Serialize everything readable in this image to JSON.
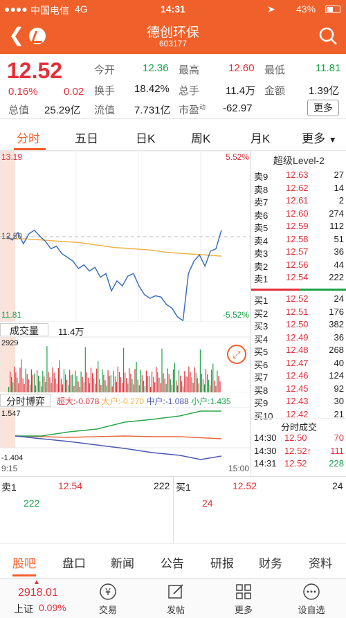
{
  "status": {
    "carrier": "中国电信",
    "network": "4G",
    "time": "14:31",
    "battery": "43%"
  },
  "header": {
    "name": "德创环保",
    "code": "603177"
  },
  "quote": {
    "price": "12.52",
    "pct": "0.16%",
    "chg": "0.02",
    "cap_label": "总值",
    "cap_value": "25.29亿",
    "open_label": "今开",
    "open_value": "12.36",
    "turnover_label": "换手",
    "turnover_value": "18.42%",
    "float_label": "流值",
    "float_value": "7.731亿",
    "high_label": "最高",
    "high_value": "12.60",
    "volume_label": "总手",
    "volume_value": "11.4万",
    "pe_label": "市盈",
    "pe_sup": "动",
    "pe_value": "-62.97",
    "low_label": "最低",
    "low_value": "11.81",
    "amount_label": "金额",
    "amount_value": "1.39亿",
    "more_label": "更多"
  },
  "tabs": [
    "分时",
    "五日",
    "日K",
    "周K",
    "月K",
    "更多"
  ],
  "chart": {
    "price_top": "13.19",
    "price_mid": "12.50",
    "price_bot": "11.81",
    "pct_top": "5.52%",
    "pct_bot": "-5.52%",
    "vol_label": "成交量",
    "vol_value": "11.4万",
    "vol_max": "2929",
    "boyi_label": "分时博弈",
    "boyi_legend": {
      "super": "超大:-0.078",
      "big": "大户:-0.270",
      "mid": "中户:-1.088",
      "small": "小户:1.435"
    },
    "boyi_top": "1.547",
    "boyi_bot": "-1.404",
    "time_start": "9:15",
    "time_end": "15:00"
  },
  "chart_data": {
    "type": "line",
    "series": [
      {
        "name": "price",
        "values": [
          12.5,
          12.47,
          12.53,
          12.44,
          12.52,
          12.55,
          12.5,
          12.46,
          12.4,
          12.42,
          12.36,
          12.33,
          12.3,
          12.24,
          12.27,
          12.22,
          12.25,
          12.17,
          12.2,
          12.06,
          12.14,
          12.1,
          12.18,
          12.2,
          12.1,
          12.03,
          12.0,
          12.02,
          12.01,
          11.95,
          11.92,
          11.85,
          11.82,
          12.2,
          12.3,
          12.35,
          12.26,
          12.38,
          12.4,
          12.55
        ]
      },
      {
        "name": "avg",
        "values": [
          12.48,
          12.48,
          12.47,
          12.46,
          12.45,
          12.43,
          12.41,
          12.4,
          12.39,
          12.37,
          12.36,
          12.35,
          12.34
        ]
      }
    ],
    "ylim": [
      11.81,
      13.19
    ]
  },
  "orderbook": {
    "title": "超级Level-2",
    "asks": [
      {
        "label": "卖9",
        "price": "12.63",
        "vol": "27"
      },
      {
        "label": "卖8",
        "price": "12.62",
        "vol": "14"
      },
      {
        "label": "卖7",
        "price": "12.61",
        "vol": "2"
      },
      {
        "label": "卖6",
        "price": "12.60",
        "vol": "274"
      },
      {
        "label": "卖5",
        "price": "12.59",
        "vol": "112"
      },
      {
        "label": "卖4",
        "price": "12.58",
        "vol": "51"
      },
      {
        "label": "卖3",
        "price": "12.57",
        "vol": "36"
      },
      {
        "label": "卖2",
        "price": "12.56",
        "vol": "44"
      },
      {
        "label": "卖1",
        "price": "12.54",
        "vol": "222"
      }
    ],
    "bids": [
      {
        "label": "买1",
        "price": "12.52",
        "vol": "24"
      },
      {
        "label": "买2",
        "price": "12.51",
        "vol": "176"
      },
      {
        "label": "买3",
        "price": "12.50",
        "vol": "382"
      },
      {
        "label": "买4",
        "price": "12.49",
        "vol": "36"
      },
      {
        "label": "买5",
        "price": "12.48",
        "vol": "268"
      },
      {
        "label": "买6",
        "price": "12.47",
        "vol": "40"
      },
      {
        "label": "买7",
        "price": "12.46",
        "vol": "124"
      },
      {
        "label": "买8",
        "price": "12.45",
        "vol": "92"
      },
      {
        "label": "买9",
        "price": "12.43",
        "vol": "30"
      },
      {
        "label": "买10",
        "price": "12.42",
        "vol": "21"
      }
    ],
    "trades_title": "分时成交",
    "trades": [
      {
        "time": "14:30",
        "price": "12.50",
        "vol": "70"
      },
      {
        "time": "14:30",
        "price": "12.52↑",
        "vol": "111"
      },
      {
        "time": "14:31",
        "price": "12.52",
        "vol": "228"
      }
    ]
  },
  "bottom_trade": {
    "sell_label": "卖1",
    "sell_price": "12.54",
    "sell_vol": "222",
    "buy_label": "买1",
    "buy_price": "12.52",
    "buy_vol": "24",
    "sell_qty": "222",
    "buy_qty": "24"
  },
  "bottom_nav": [
    "股吧",
    "盘口",
    "新闻",
    "公告",
    "研报",
    "财务",
    "资料"
  ],
  "toolbar": {
    "index_value": "2918.01",
    "index_name": "上证",
    "index_pct": "0.09%",
    "trade": "交易",
    "post": "发帖",
    "more": "更多",
    "settings": "设自选"
  }
}
